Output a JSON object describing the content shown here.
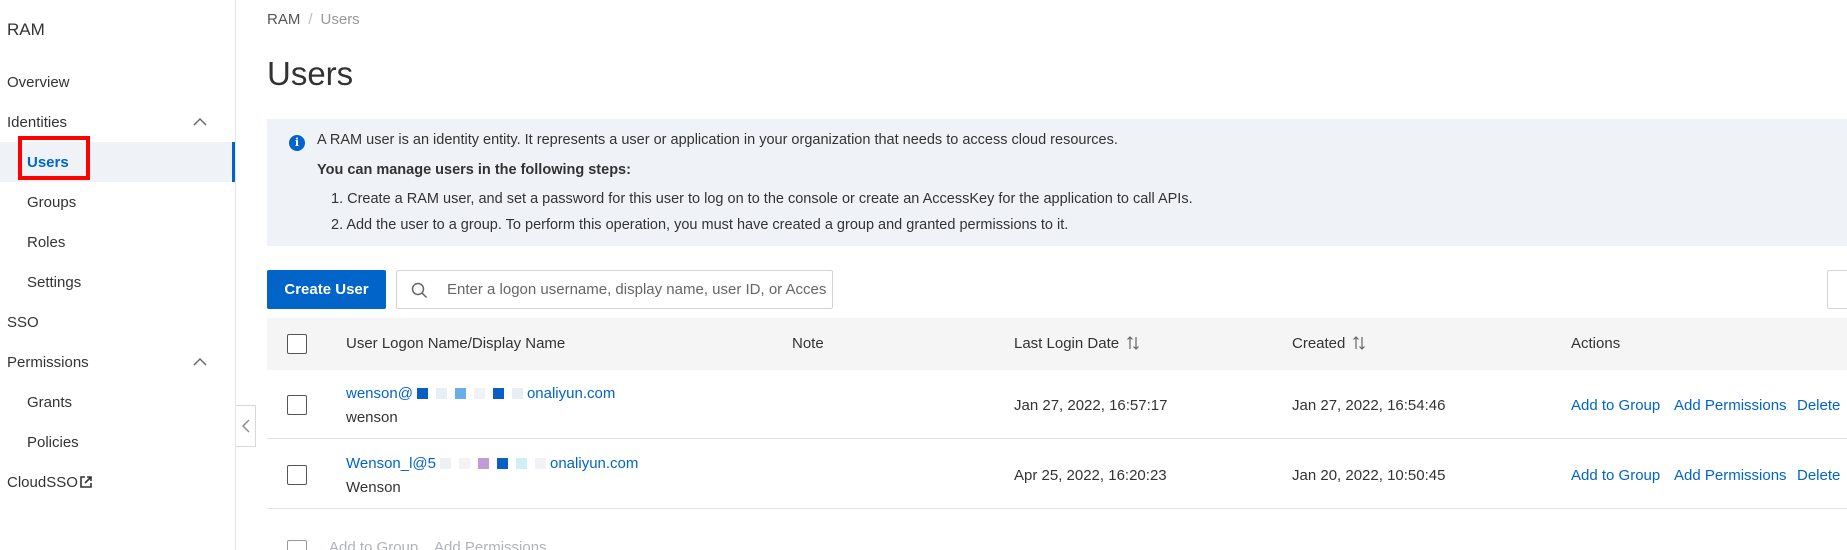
{
  "sidebar": {
    "title": "RAM",
    "items": [
      {
        "label": "Overview"
      },
      {
        "label": "Identities"
      },
      {
        "label": "Users"
      },
      {
        "label": "Groups"
      },
      {
        "label": "Roles"
      },
      {
        "label": "Settings"
      },
      {
        "label": "SSO"
      },
      {
        "label": "Permissions"
      },
      {
        "label": "Grants"
      },
      {
        "label": "Policies"
      },
      {
        "label": "CloudSSO"
      }
    ]
  },
  "breadcrumb": {
    "root": "RAM",
    "sep": "/",
    "current": "Users"
  },
  "page": {
    "title": "Users"
  },
  "info": {
    "line1": "A RAM user is an identity entity. It represents a user or application in your organization that needs to access cloud resources.",
    "line2": "You can manage users in the following steps:",
    "step1": "1. Create a RAM user, and set a password for this user to log on to the console or create an AccessKey for the application to call APIs.",
    "step2": "2. Add the user to a group. To perform this operation, you must have created a group and granted permissions to it."
  },
  "toolbar": {
    "create_label": "Create User",
    "search_placeholder": "Enter a logon username, display name, user ID, or AccessKey ID"
  },
  "table": {
    "headers": {
      "name": "User Logon Name/Display Name",
      "note": "Note",
      "last_login": "Last Login Date",
      "created": "Created",
      "actions": "Actions"
    },
    "rows": [
      {
        "logon_prefix": "wenson@",
        "logon_suffix": "onaliyun.com",
        "display": "wenson",
        "last_login": "Jan 27, 2022, 16:57:17",
        "created": "Jan 27, 2022, 16:54:46"
      },
      {
        "logon_prefix": "Wenson_l@5",
        "logon_suffix": "onaliyun.com",
        "display": "Wenson",
        "last_login": "Apr 25, 2022, 16:20:23",
        "created": "Jan 20, 2022, 10:50:45"
      }
    ],
    "actions": {
      "add_group": "Add to Group",
      "add_perm": "Add Permissions",
      "delete": "Delete"
    },
    "footer": {
      "add_group": "Add to Group",
      "add_perm": "Add Permissions"
    }
  },
  "colors": {
    "accent": "#0064c8",
    "highlight": "#ff0000",
    "info_bg": "#eff3f8"
  }
}
